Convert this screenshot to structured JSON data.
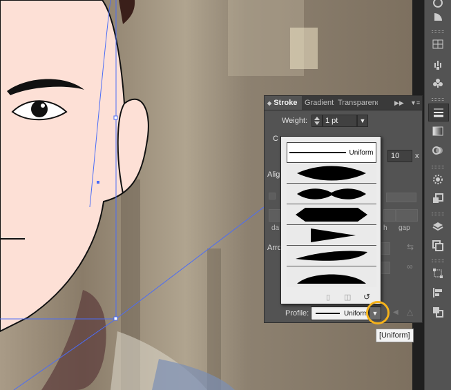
{
  "panel": {
    "tabs": [
      {
        "label": "Stroke"
      },
      {
        "label": "Gradient"
      },
      {
        "label": "Transparency"
      }
    ],
    "weight_label": "Weight:",
    "weight_value": "1 pt",
    "cap_label_partial": "C",
    "limit_value": "10",
    "limit_unit": "x",
    "align_label_partial": "Alig",
    "arrow_label_partial": "Arro",
    "dash_labels": [
      "da",
      "h",
      "gap"
    ],
    "profile_label": "Profile:",
    "profile_value": "Uniform"
  },
  "profile_menu": {
    "options": [
      {
        "name": "uniform",
        "label": "Uniform"
      },
      {
        "name": "width-profile-1",
        "label": ""
      },
      {
        "name": "width-profile-2",
        "label": ""
      },
      {
        "name": "width-profile-3",
        "label": ""
      },
      {
        "name": "width-profile-4",
        "label": ""
      },
      {
        "name": "width-profile-5",
        "label": ""
      },
      {
        "name": "width-profile-6",
        "label": ""
      }
    ]
  },
  "tooltip": "[Uniform]",
  "colors": {
    "panel_bg": "#535353",
    "highlight": "#f5b21b",
    "selection_blue": "#4a6cf7",
    "skin": "#fde0d6"
  },
  "icons": [
    "panel-expand-icon",
    "panel-menu-icon",
    "spin-arrows-icon",
    "dropdown-arrow-icon",
    "delete-profile-icon",
    "add-profile-icon",
    "reset-profile-icon",
    "flip-icon"
  ]
}
